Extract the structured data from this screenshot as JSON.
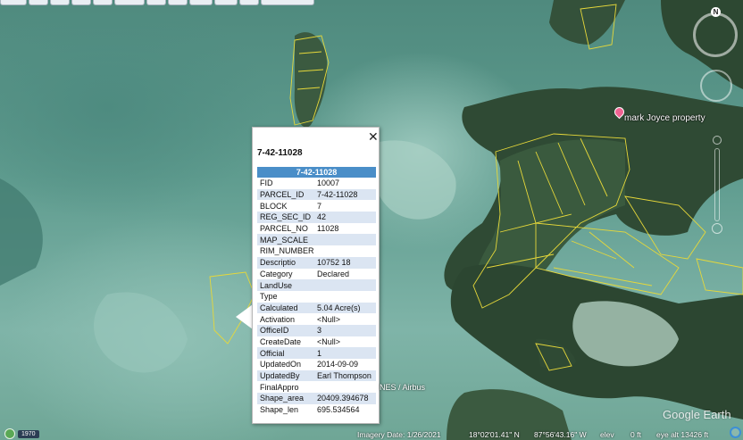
{
  "placemark": {
    "label": "mark Joyce property"
  },
  "balloon": {
    "close_symbol": "✕",
    "title": "7-42-11028",
    "table_header": "7-42-11028",
    "rows": [
      {
        "key": "FID",
        "value": "10007"
      },
      {
        "key": "PARCEL_ID",
        "value": "7-42-11028"
      },
      {
        "key": "BLOCK",
        "value": "7"
      },
      {
        "key": "REG_SEC_ID",
        "value": "42"
      },
      {
        "key": "PARCEL_NO",
        "value": "11028"
      },
      {
        "key": "MAP_SCALE",
        "value": ""
      },
      {
        "key": "RIM_NUMBER",
        "value": ""
      },
      {
        "key": "Descriptio",
        "value": "10752 18"
      },
      {
        "key": "Category",
        "value": "Declared"
      },
      {
        "key": "LandUse",
        "value": ""
      },
      {
        "key": "Type",
        "value": ""
      },
      {
        "key": "Calculated",
        "value": "5.04 Acre(s)"
      },
      {
        "key": "Activation",
        "value": "<Null>"
      },
      {
        "key": "OfficeID",
        "value": "3"
      },
      {
        "key": "CreateDate",
        "value": "<Null>"
      },
      {
        "key": "Official",
        "value": "1"
      },
      {
        "key": "UpdatedOn",
        "value": "2014-09-09"
      },
      {
        "key": "UpdatedBy",
        "value": "Earl Thompson"
      },
      {
        "key": "FinalAppro",
        "value": ""
      },
      {
        "key": "Shape_area",
        "value": "20409.394678"
      },
      {
        "key": "Shape_len",
        "value": "695.534564"
      }
    ]
  },
  "copyright": "NES / Airbus",
  "history": {
    "year": "1970"
  },
  "watermark": "Google Earth",
  "compass": {
    "north": "N"
  },
  "status": {
    "imagery_date": "Imagery Date: 1/26/2021",
    "lat": "18°02'01.41\" N",
    "lon": "87°56'43.16\" W",
    "elev_label": "elev",
    "elev_value": "0 ft",
    "eye_alt": "eye alt  13426 ft"
  },
  "colors": {
    "parcel_outline": "#e6d83a",
    "table_header": "#4a8ec8",
    "row_stripe": "#dbe5f2",
    "placemark_pin": "#f06292"
  }
}
